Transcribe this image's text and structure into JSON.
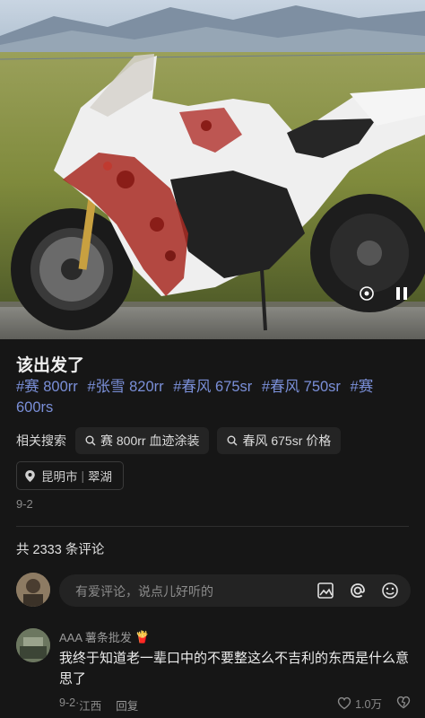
{
  "post": {
    "title": "该出发了",
    "hashtags": [
      "#赛 800rr",
      "#张雪 820rr",
      "#春风 675sr",
      "#春风 750sr",
      "#赛 600rs"
    ],
    "date": "9-2"
  },
  "related_search": {
    "label": "相关搜索",
    "chips": [
      "赛 800rr 血迹涂装",
      "春风 675sr 价格"
    ]
  },
  "location": {
    "city": "昆明市",
    "area": "翠湖"
  },
  "comments_section": {
    "count_text": "共 2333 条评论",
    "input_placeholder": "有爱评论，说点儿好听的"
  },
  "comment": {
    "username": "AAA 薯条批发",
    "badge_emoji": "🍟",
    "text": "我终于知道老一辈口中的不要整这么不吉利的东西是什么意思了",
    "meta_date": "9-2",
    "meta_location": "江西",
    "reply_label": "回复",
    "like_count": "1.0万"
  },
  "icons": {
    "search": "magnifier-icon",
    "location": "pin-icon",
    "image": "image-icon",
    "mention": "at-icon",
    "emoji": "smile-icon",
    "like": "heart-icon",
    "dislike": "dislike-icon"
  },
  "colors": {
    "background": "#161616",
    "hashtag": "#7a8fd8",
    "chip_bg": "#242424"
  }
}
